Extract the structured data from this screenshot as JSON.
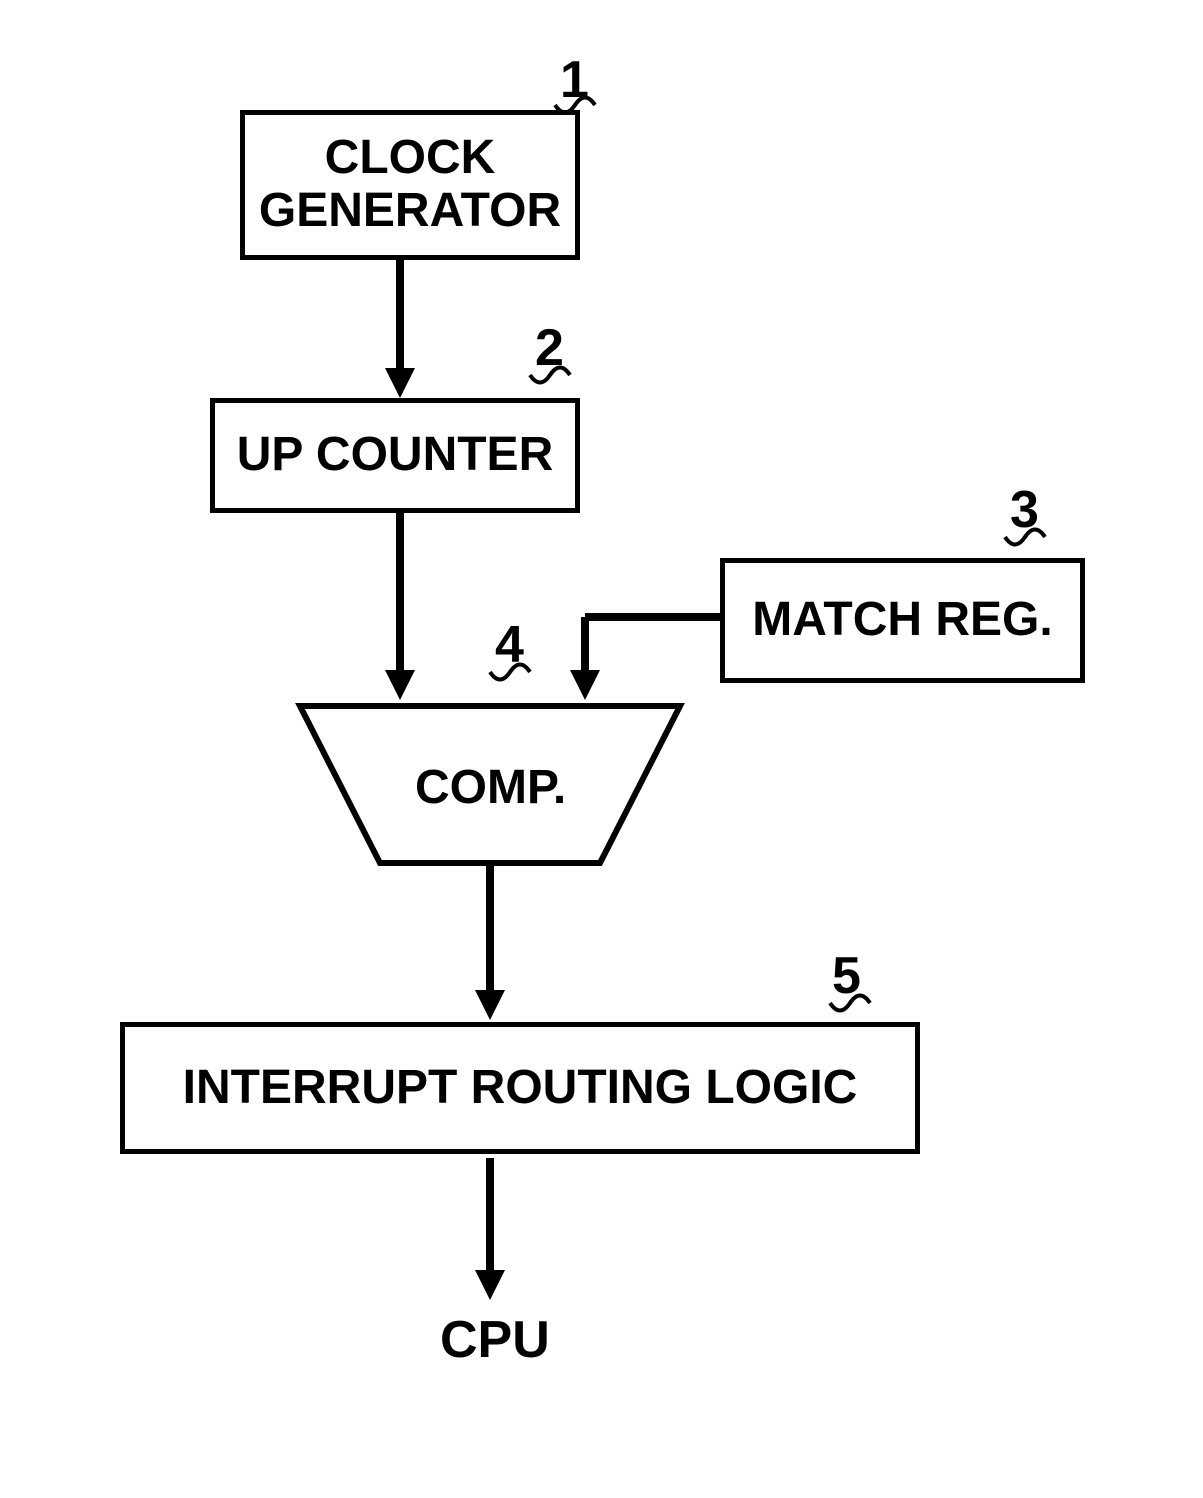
{
  "blocks": {
    "clock_generator": "CLOCK\nGENERATOR",
    "up_counter": "UP COUNTER",
    "match_reg": "MATCH REG.",
    "comp": "COMP.",
    "interrupt_routing": "INTERRUPT ROUTING LOGIC",
    "cpu": "CPU"
  },
  "labels": {
    "n1": "1",
    "n2": "2",
    "n3": "3",
    "n4": "4",
    "n5": "5"
  }
}
